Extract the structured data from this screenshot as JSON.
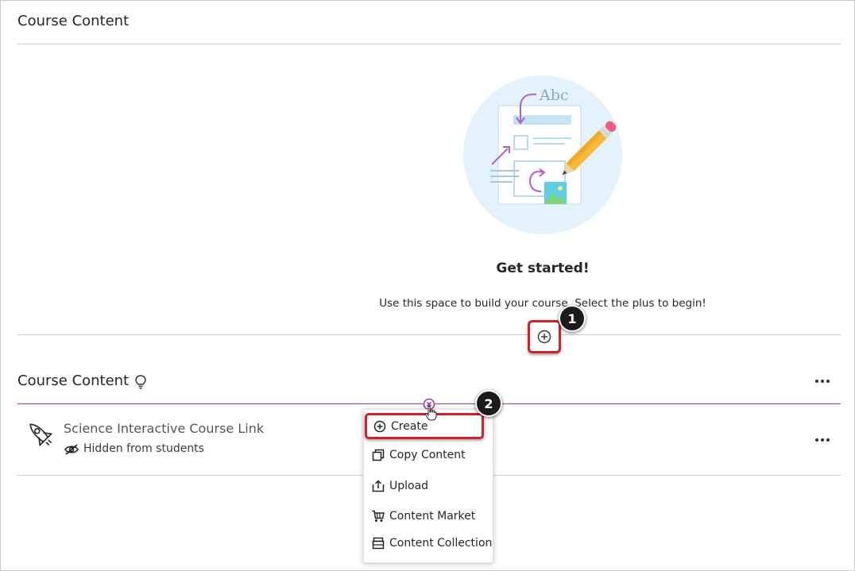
{
  "top_section": {
    "title": "Course Content"
  },
  "empty_state": {
    "illustration_label": "Abc",
    "heading": "Get started!",
    "description": "Use this space to build your course. Select the plus to begin!"
  },
  "callouts": {
    "one": "1",
    "two": "2"
  },
  "course_content": {
    "title": "Course Content",
    "items": [
      {
        "title": "Science Interactive Course Link",
        "status": "Hidden from students"
      }
    ]
  },
  "add_menu": {
    "items": [
      {
        "label": "Create",
        "icon": "plus-circle-icon"
      },
      {
        "label": "Copy Content",
        "icon": "copy-icon"
      },
      {
        "label": "Upload",
        "icon": "upload-icon"
      },
      {
        "label": "Content Market",
        "icon": "cart-icon"
      },
      {
        "label": "Content Collection",
        "icon": "collection-icon"
      }
    ]
  },
  "colors": {
    "highlight_red": "#d0202a",
    "accent_purple": "#9c3c9a",
    "illustration_bg": "#e3f2fb",
    "pencil_yellow": "#f6b93b"
  }
}
